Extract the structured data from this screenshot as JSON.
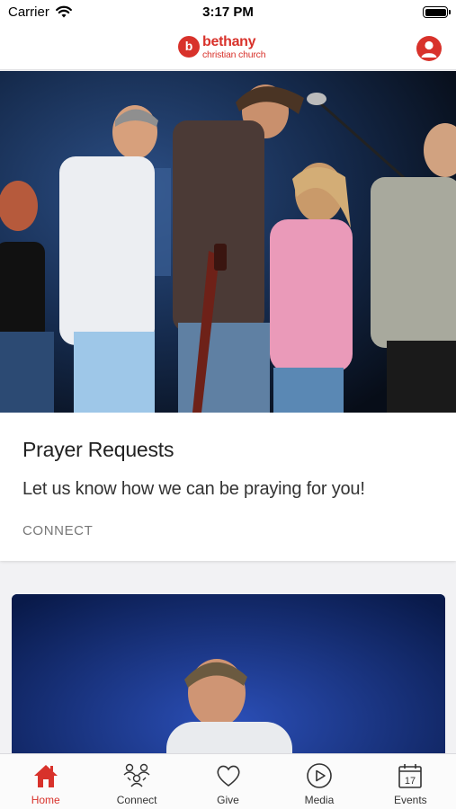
{
  "status_bar": {
    "carrier": "Carrier",
    "time": "3:17 PM"
  },
  "header": {
    "logo_mark": "b",
    "logo_name": "bethany",
    "logo_sub": "christian church"
  },
  "cards": [
    {
      "title": "Prayer Requests",
      "description": "Let us know how we can be praying for you!",
      "category": "CONNECT"
    }
  ],
  "tabs": [
    {
      "label": "Home",
      "icon": "home-icon",
      "active": true
    },
    {
      "label": "Connect",
      "icon": "people-icon",
      "active": false
    },
    {
      "label": "Give",
      "icon": "heart-icon",
      "active": false
    },
    {
      "label": "Media",
      "icon": "play-circle-icon",
      "active": false
    },
    {
      "label": "Events",
      "icon": "calendar-icon",
      "active": false,
      "badge_day": "17"
    }
  ],
  "colors": {
    "brand": "#d8322b",
    "tab_inactive": "#333333",
    "background": "#f2f2f4"
  }
}
